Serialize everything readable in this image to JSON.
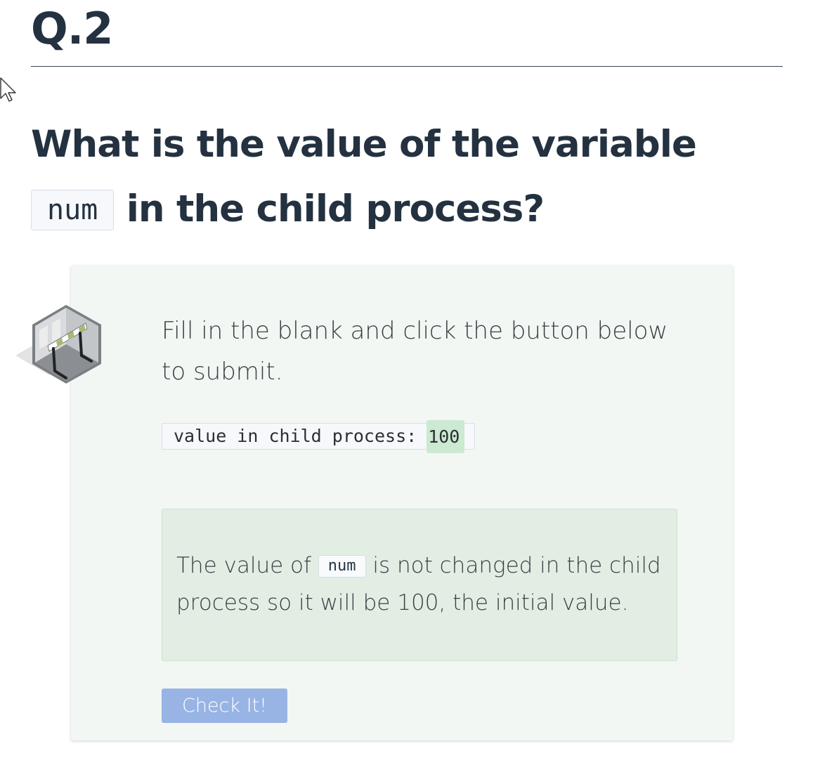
{
  "question": {
    "number": "Q.2",
    "text_before": "What is the value of the variable",
    "code": "num",
    "text_after": "in the child process?"
  },
  "card": {
    "instruction": "Fill in the blank and click the button below to submit.",
    "blank": {
      "prefix": "value in child process:",
      "value": "100"
    },
    "feedback": {
      "text_before": "The value of",
      "code": "num",
      "text_after": "is not changed in the child process so it will be 100, the initial value."
    },
    "check_button_label": "Check It!"
  },
  "colors": {
    "card_background": "#f2f7f3",
    "feedback_background": "#e2eee3",
    "input_highlight": "#cce9d2",
    "button_background": "#98b4e5",
    "heading_text": "#243140"
  },
  "icons": {
    "cursor": "mouse-pointer-icon",
    "badge": "barrier-room-icon"
  }
}
